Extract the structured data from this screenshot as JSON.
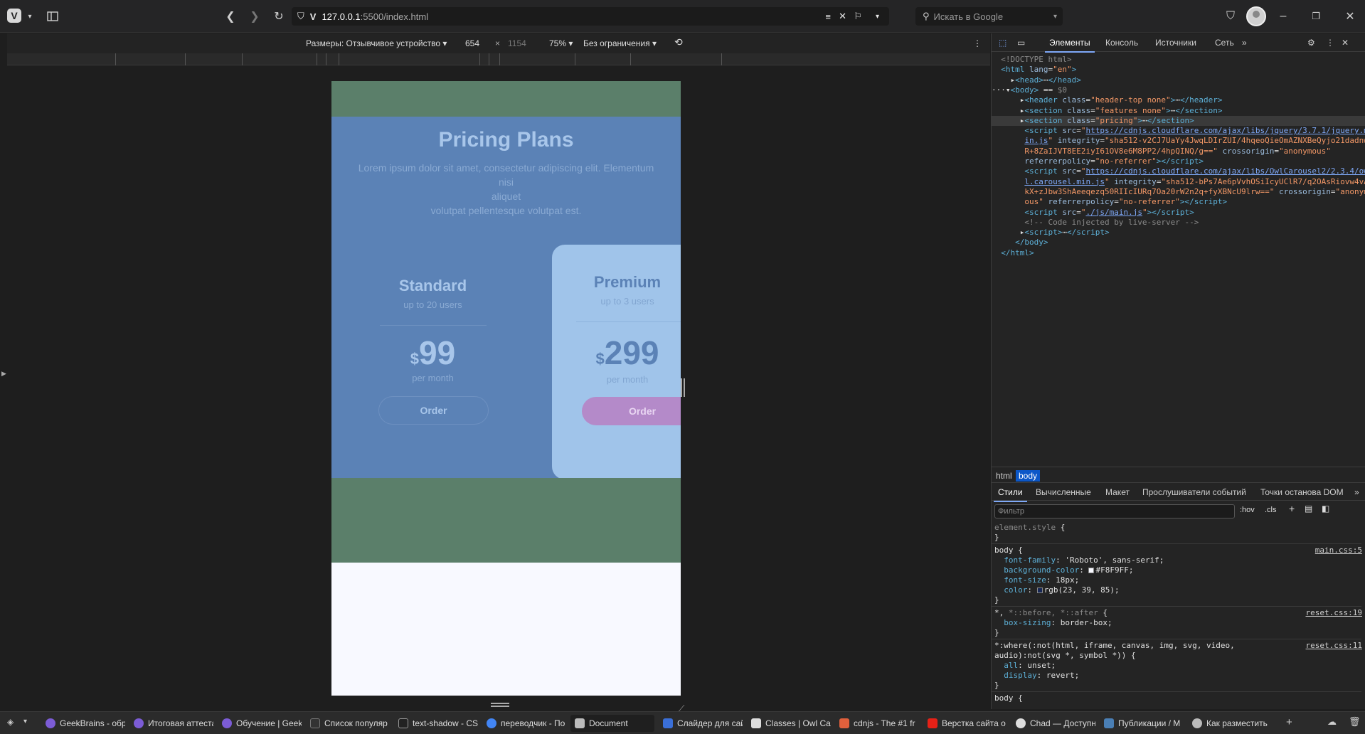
{
  "browser": {
    "url_host": "127.0.0.1",
    "url_path": ":5500/index.html",
    "search_placeholder": "Искать в Google"
  },
  "devicebar": {
    "dimensions_label": "Размеры: Отзывчивое устройство ▾",
    "width": "654",
    "times": "×",
    "height": "1154",
    "zoom": "75% ▾",
    "throttle": "Без ограничения ▾"
  },
  "page": {
    "title": "Pricing Plans",
    "desc_line1": "Lorem ipsum dolor sit amet, consectetur adipiscing elit. Elementum nisi",
    "desc_line2": "aliquet",
    "desc_line3": "volutpat pellentesque volutpat est.",
    "standard": {
      "name": "Standard",
      "users": "up to 20 users",
      "currency": "$",
      "price": "99",
      "period": "per month",
      "button": "Order"
    },
    "premium": {
      "name": "Premium",
      "users": "up to 3 users",
      "currency": "$",
      "price": "299",
      "period": "per month",
      "button": "Order"
    }
  },
  "devtools": {
    "tabs": [
      "Элементы",
      "Консоль",
      "Источники",
      "Сеть"
    ],
    "crumbs": [
      "html",
      "body"
    ],
    "style_tabs": [
      "Стили",
      "Вычисленные",
      "Макет",
      "Прослушиватели событий",
      "Точки останова DOM"
    ],
    "filter_placeholder": "Фильтр",
    "hov": ":hov",
    "cls": ".cls"
  },
  "bottom_tabs": [
    "GeekBrains - обр",
    "Итоговая аттеста",
    "Обучение | Geek",
    "Список популяр",
    "text-shadow - CS",
    "переводчик - По",
    "Document",
    "Слайдер для сай",
    "Classes | Owl Car",
    "cdnjs - The #1 fr",
    "Верстка сайта о",
    "Chad — Доступн",
    "Публикации / M",
    "Как разместить"
  ],
  "colors": {
    "pricing_bg": "#5b82b6",
    "green_band": "#5b7f6a",
    "premium_card": "#a0c4ea",
    "order_button": "#b48ac9"
  }
}
